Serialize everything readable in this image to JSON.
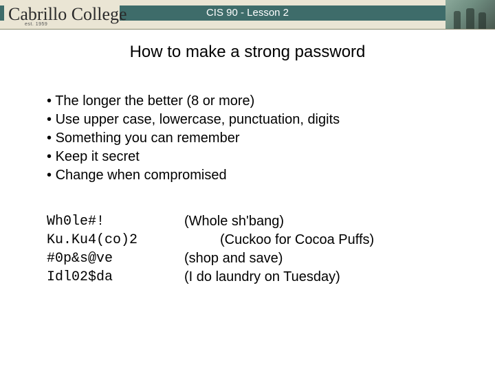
{
  "header": {
    "logo_text": "Cabrillo College",
    "logo_sub": "est. 1959",
    "course_title": "CIS 90 - Lesson 2"
  },
  "slide": {
    "title": "How to make a strong password",
    "bullets": [
      "The longer the better (8 or more)",
      "Use upper case, lowercase, punctuation, digits",
      "Something you can remember",
      "Keep it secret",
      "Change when compromised"
    ],
    "examples": [
      {
        "password": "Wh0le#!",
        "hint": "(Whole sh'bang)",
        "indent": false
      },
      {
        "password": "Ku.Ku4(co)2",
        "hint": "(Cuckoo for Cocoa Puffs)",
        "indent": true
      },
      {
        "password": "#0p&s@ve",
        "hint": "(shop and save)",
        "indent": false
      },
      {
        "password": "Idl02$da",
        "hint": "(I do laundry on Tuesday)",
        "indent": false
      }
    ]
  }
}
